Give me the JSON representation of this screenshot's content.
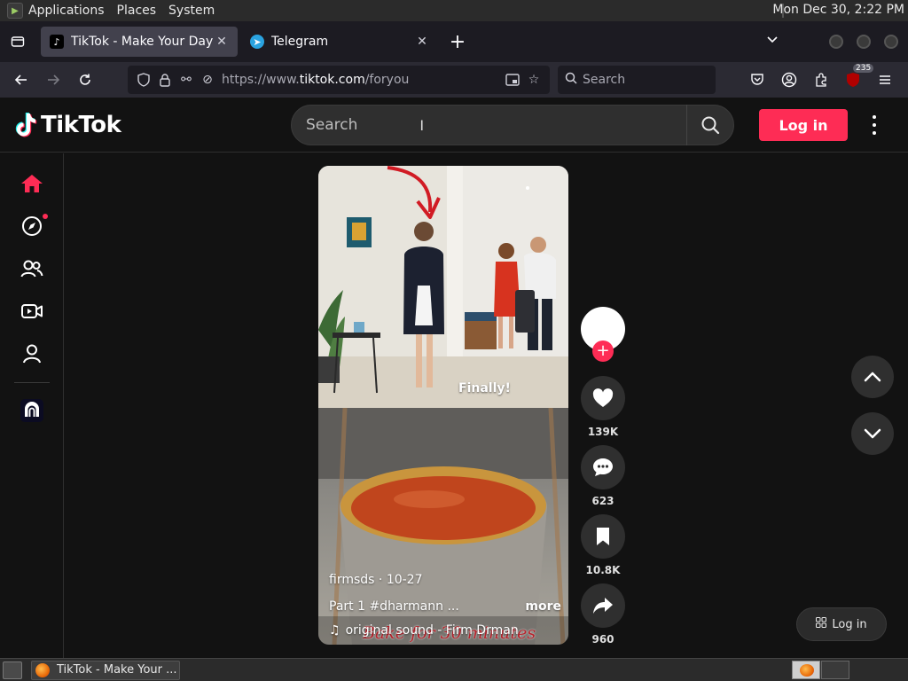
{
  "gnome": {
    "menus": [
      "Applications",
      "Places",
      "System"
    ],
    "clock": "Mon Dec 30,  2:22 PM"
  },
  "browser": {
    "tabs": [
      {
        "title": "TikTok - Make Your Day",
        "active": true
      },
      {
        "title": "Telegram",
        "active": false
      }
    ],
    "url_prefix": "https://www.",
    "url_host": "tiktok.com",
    "url_path": "/foryou",
    "search_placeholder": "Search",
    "extension_badge": "235"
  },
  "tiktok": {
    "logo_text": "TikTok",
    "search_placeholder": "Search",
    "login_label": "Log in",
    "accent": "#fe2c55",
    "sidebar": [
      "home-icon",
      "explore-icon",
      "following-icon",
      "live-icon",
      "profile-icon",
      "creators-icon"
    ],
    "video": {
      "overlay_text_top": "Finally!",
      "overlay_text_bottom": "Bake for 30 minutes",
      "author": "firmsds",
      "date": "10-27",
      "description": "Part 1 #dharmann  ...",
      "more": "more",
      "sound": "original sound - Firm Drman"
    },
    "actions": {
      "likes": "139K",
      "comments": "623",
      "saves": "10.8K",
      "shares": "960"
    },
    "login_pill": "Log in"
  },
  "taskbar": {
    "item": "TikTok - Make Your ..."
  }
}
